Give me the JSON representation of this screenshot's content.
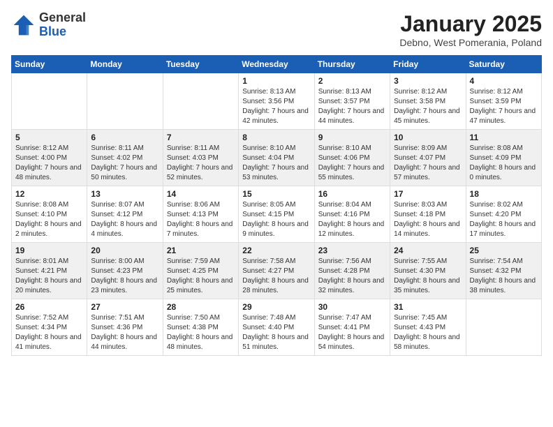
{
  "header": {
    "logo_general": "General",
    "logo_blue": "Blue",
    "month_title": "January 2025",
    "location": "Debno, West Pomerania, Poland"
  },
  "weekdays": [
    "Sunday",
    "Monday",
    "Tuesday",
    "Wednesday",
    "Thursday",
    "Friday",
    "Saturday"
  ],
  "weeks": [
    [
      {
        "day": "",
        "info": ""
      },
      {
        "day": "",
        "info": ""
      },
      {
        "day": "",
        "info": ""
      },
      {
        "day": "1",
        "info": "Sunrise: 8:13 AM\nSunset: 3:56 PM\nDaylight: 7 hours and 42 minutes."
      },
      {
        "day": "2",
        "info": "Sunrise: 8:13 AM\nSunset: 3:57 PM\nDaylight: 7 hours and 44 minutes."
      },
      {
        "day": "3",
        "info": "Sunrise: 8:12 AM\nSunset: 3:58 PM\nDaylight: 7 hours and 45 minutes."
      },
      {
        "day": "4",
        "info": "Sunrise: 8:12 AM\nSunset: 3:59 PM\nDaylight: 7 hours and 47 minutes."
      }
    ],
    [
      {
        "day": "5",
        "info": "Sunrise: 8:12 AM\nSunset: 4:00 PM\nDaylight: 7 hours and 48 minutes."
      },
      {
        "day": "6",
        "info": "Sunrise: 8:11 AM\nSunset: 4:02 PM\nDaylight: 7 hours and 50 minutes."
      },
      {
        "day": "7",
        "info": "Sunrise: 8:11 AM\nSunset: 4:03 PM\nDaylight: 7 hours and 52 minutes."
      },
      {
        "day": "8",
        "info": "Sunrise: 8:10 AM\nSunset: 4:04 PM\nDaylight: 7 hours and 53 minutes."
      },
      {
        "day": "9",
        "info": "Sunrise: 8:10 AM\nSunset: 4:06 PM\nDaylight: 7 hours and 55 minutes."
      },
      {
        "day": "10",
        "info": "Sunrise: 8:09 AM\nSunset: 4:07 PM\nDaylight: 7 hours and 57 minutes."
      },
      {
        "day": "11",
        "info": "Sunrise: 8:08 AM\nSunset: 4:09 PM\nDaylight: 8 hours and 0 minutes."
      }
    ],
    [
      {
        "day": "12",
        "info": "Sunrise: 8:08 AM\nSunset: 4:10 PM\nDaylight: 8 hours and 2 minutes."
      },
      {
        "day": "13",
        "info": "Sunrise: 8:07 AM\nSunset: 4:12 PM\nDaylight: 8 hours and 4 minutes."
      },
      {
        "day": "14",
        "info": "Sunrise: 8:06 AM\nSunset: 4:13 PM\nDaylight: 8 hours and 7 minutes."
      },
      {
        "day": "15",
        "info": "Sunrise: 8:05 AM\nSunset: 4:15 PM\nDaylight: 8 hours and 9 minutes."
      },
      {
        "day": "16",
        "info": "Sunrise: 8:04 AM\nSunset: 4:16 PM\nDaylight: 8 hours and 12 minutes."
      },
      {
        "day": "17",
        "info": "Sunrise: 8:03 AM\nSunset: 4:18 PM\nDaylight: 8 hours and 14 minutes."
      },
      {
        "day": "18",
        "info": "Sunrise: 8:02 AM\nSunset: 4:20 PM\nDaylight: 8 hours and 17 minutes."
      }
    ],
    [
      {
        "day": "19",
        "info": "Sunrise: 8:01 AM\nSunset: 4:21 PM\nDaylight: 8 hours and 20 minutes."
      },
      {
        "day": "20",
        "info": "Sunrise: 8:00 AM\nSunset: 4:23 PM\nDaylight: 8 hours and 23 minutes."
      },
      {
        "day": "21",
        "info": "Sunrise: 7:59 AM\nSunset: 4:25 PM\nDaylight: 8 hours and 25 minutes."
      },
      {
        "day": "22",
        "info": "Sunrise: 7:58 AM\nSunset: 4:27 PM\nDaylight: 8 hours and 28 minutes."
      },
      {
        "day": "23",
        "info": "Sunrise: 7:56 AM\nSunset: 4:28 PM\nDaylight: 8 hours and 32 minutes."
      },
      {
        "day": "24",
        "info": "Sunrise: 7:55 AM\nSunset: 4:30 PM\nDaylight: 8 hours and 35 minutes."
      },
      {
        "day": "25",
        "info": "Sunrise: 7:54 AM\nSunset: 4:32 PM\nDaylight: 8 hours and 38 minutes."
      }
    ],
    [
      {
        "day": "26",
        "info": "Sunrise: 7:52 AM\nSunset: 4:34 PM\nDaylight: 8 hours and 41 minutes."
      },
      {
        "day": "27",
        "info": "Sunrise: 7:51 AM\nSunset: 4:36 PM\nDaylight: 8 hours and 44 minutes."
      },
      {
        "day": "28",
        "info": "Sunrise: 7:50 AM\nSunset: 4:38 PM\nDaylight: 8 hours and 48 minutes."
      },
      {
        "day": "29",
        "info": "Sunrise: 7:48 AM\nSunset: 4:40 PM\nDaylight: 8 hours and 51 minutes."
      },
      {
        "day": "30",
        "info": "Sunrise: 7:47 AM\nSunset: 4:41 PM\nDaylight: 8 hours and 54 minutes."
      },
      {
        "day": "31",
        "info": "Sunrise: 7:45 AM\nSunset: 4:43 PM\nDaylight: 8 hours and 58 minutes."
      },
      {
        "day": "",
        "info": ""
      }
    ]
  ]
}
